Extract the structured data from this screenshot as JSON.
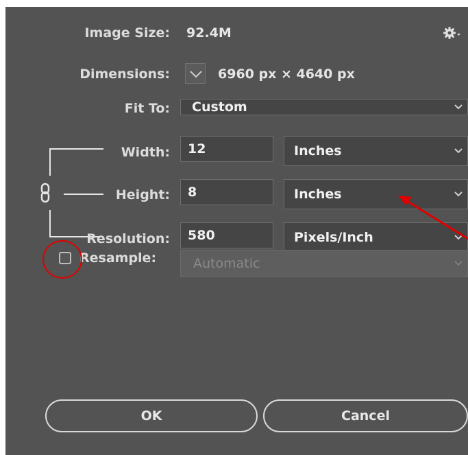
{
  "dialog": {
    "image_size_label": "Image Size:",
    "image_size_value": "92.4M",
    "gear_icon": "gear-icon",
    "dimensions_label": "Dimensions:",
    "dimensions_value": "6960 px  ×  4640 px",
    "fit_to_label": "Fit To:",
    "fit_to_value": "Custom",
    "width_label": "Width:",
    "width_value": "12",
    "width_unit": "Inches",
    "height_label": "Height:",
    "height_value": "8",
    "height_unit": "Inches",
    "resolution_label": "Resolution:",
    "resolution_value": "580",
    "resolution_unit": "Pixels/Inch",
    "resample_label": "Resample:",
    "resample_checked": false,
    "resample_value": "Automatic",
    "ok_label": "OK",
    "cancel_label": "Cancel"
  },
  "colors": {
    "dialog_background": "#535353",
    "field_background": "#454545",
    "annotation": "#e00000"
  }
}
